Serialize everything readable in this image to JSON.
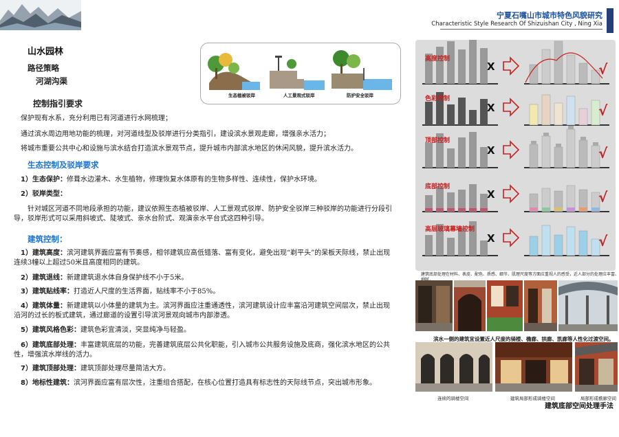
{
  "header": {
    "title": "宁夏石嘴山市城市特色风貌研究",
    "subtitle": "Characteristic  Style Research Of Shizuishan City , Ning Xia"
  },
  "page": {
    "main_title": "山水园林",
    "strategy": "路径策略",
    "river": "河湖沟渠",
    "guideline": "控制指引要求"
  },
  "bank_types": [
    "生态植被驳岸",
    "人工景观式驳岸",
    "防护安全驳岸"
  ],
  "intro": [
    "保护现有水系，充分利用已有河道进行水网梳理；",
    "通过滨水周边用地功能的梳理，对河道线型及驳岸进行分类指引，建设滨水景观走廊，增强亲水活力；",
    "将城市重要公共中心和设施与滨水结合打造滨水景观节点，提升城市内部滨水地区的休闲风貌，提升滨水活力。"
  ],
  "ecology": {
    "heading": "生态控制及驳岸要求",
    "items": [
      {
        "label": "1）生态保护：",
        "text": "修葺水边灌木、水生植物，修理恢复水体原有的生物多样性、连续性，保护水环境。"
      },
      {
        "label": "2）驳岸类型：",
        "text": ""
      }
    ],
    "para": "针对城区河道不同地段承担的功能，建议依照生态植被驳岸、人工景观式驳岸、防护安全驳岸三种驳岸的功能进行分段引导，驳岸形式可以采用斜坡式、陡坡式、亲水台阶式、观演亲水平台式这四种引导。"
  },
  "building": {
    "heading": "建筑控制：",
    "items": [
      {
        "label": "1）建筑高度：",
        "text": "滨河建筑界面应富有节奏感，相邻建筑应高低错落、富有变化，避免出现“剃平头”的呆板天际线，禁止出现连续3幢以上超过50米且高度相同的建筑。"
      },
      {
        "label": "2）建筑退线：",
        "text": "新建建筑退水体自身保护线不小于5米。"
      },
      {
        "label": "3）建筑贴线率：",
        "text": "打造近人尺度的生活界面，贴线率不小于85%。"
      },
      {
        "label": "4）建筑体量：",
        "text": "新建建筑以小体量的建筑为主。滨河界面应注重通透性，滨河建筑设计应丰富沿河建筑空间层次，禁止出现沿河的过长的板式建筑，通过廊道的设置引导滨河景观向城市内部渗透。"
      },
      {
        "label": "5）建筑风格色彩：",
        "text": "建筑色彩宜清淡，突显纯净与轻盈。"
      },
      {
        "label": "6）建筑底部处理：",
        "text": "丰富建筑底层的功能，完善建筑底层公共化职能，引入城市公共服务设施及底商，强化滨水地区的公共性，增强滨水岸线的活力。"
      },
      {
        "label": "7）建筑顶部处理：",
        "text": "建筑顶部处理尽量简洁大方。"
      },
      {
        "label": "8）地标性建筑：",
        "text": "滨河界面应富有层次性，注重组合搭配，在核心位置打造具有标志性的天际线节点，突出城市形象。"
      }
    ]
  },
  "controls": [
    "高度控制",
    "色彩控制",
    "顶部控制",
    "底部控制",
    "高层玻璃幕墙控制"
  ],
  "marks": {
    "wrong": "X",
    "right": "√"
  },
  "panel_caption": "建筑底部处理在材料、表皮、配色、质感、细节、肌理尺度等方面应重视人的感受，近人部分的处理应丰富、细腻。",
  "photo_row1_caption": "滨水一侧的建筑宜设置近人尺度的骑楼、檐廊、拱廊、凯廊等人性化过渡空间。",
  "photo_row2_captions": [
    "连续的骑楼空间",
    "建筑局部形成骑楼空间",
    "局部形成檐廊空间"
  ],
  "final_label": "建筑底部空间处理手法",
  "colors": {
    "accent_blue": "#1a73d8",
    "red": "#c81e1e",
    "navy": "#243f7a"
  }
}
